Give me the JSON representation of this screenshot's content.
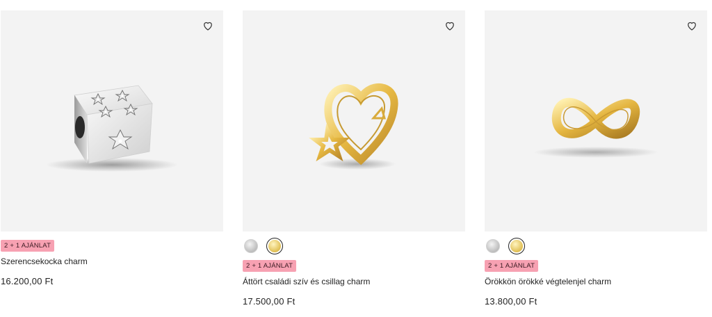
{
  "products": [
    {
      "name": "Szerencsekocka charm",
      "price": "16.200,00 Ft",
      "badge": "2 + 1 AJÁNLAT",
      "image_alt": "silver-dice-charm"
    },
    {
      "name": "Áttört családi szív és csillag charm",
      "price": "17.500,00 Ft",
      "badge": "2 + 1 AJÁNLAT",
      "image_alt": "gold-heart-star-charm",
      "swatches": [
        "silver",
        "gold"
      ]
    },
    {
      "name": "Örökkön örökké végtelenjel charm",
      "price": "13.800,00 Ft",
      "badge": "2 + 1 AJÁNLAT",
      "image_alt": "gold-infinity-charm",
      "swatches": [
        "silver",
        "gold"
      ]
    }
  ],
  "colors": {
    "card_bg": "#f3f3f3",
    "badge_bg": "#f7a1b2",
    "gold": "#e2c25a",
    "silver": "#bdbdbd"
  },
  "icons": {
    "wishlist": "heart-outline-icon"
  }
}
